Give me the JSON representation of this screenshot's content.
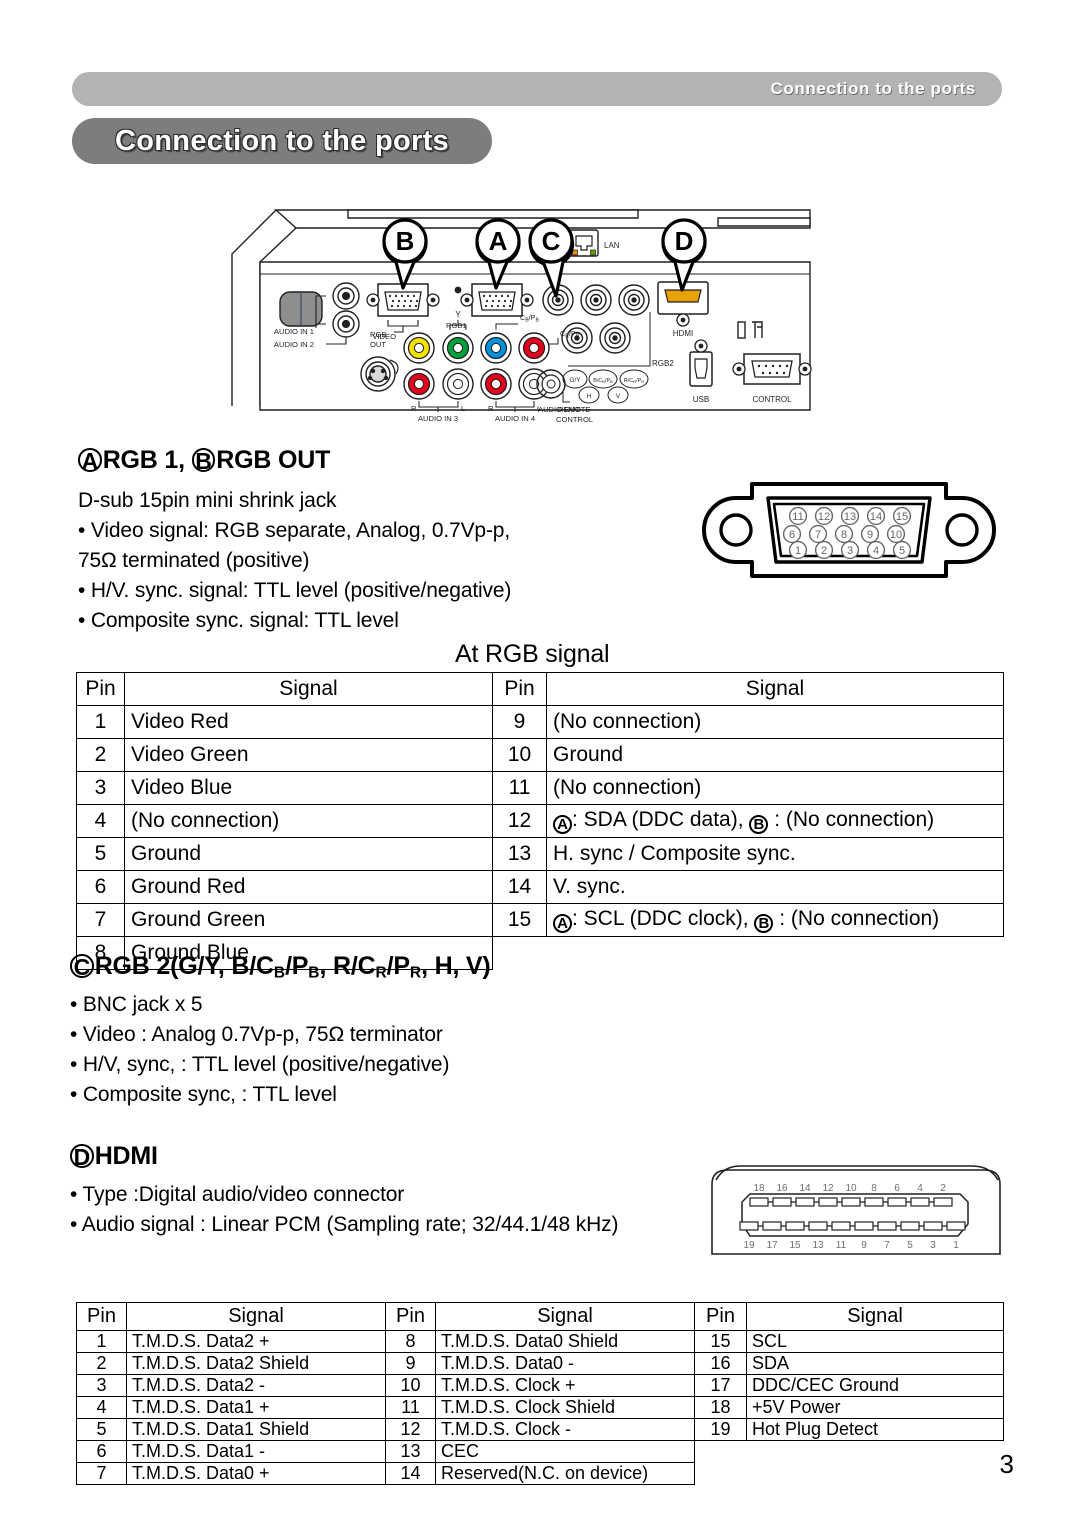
{
  "header": {
    "running_title": "Connection to the ports",
    "chapter_title": "Connection to the ports"
  },
  "diagram": {
    "callouts": [
      "B",
      "A",
      "C",
      "D"
    ],
    "labels": {
      "audio_in_1": "AUDIO IN 1",
      "audio_in_2": "AUDIO IN 2",
      "rgb_out": "RGB\nOUT",
      "rgb_out_l1": "RGB",
      "rgb_out_l2": "OUT",
      "rgb1": "RGB1",
      "video": "VIDEO",
      "y": "Y",
      "cb_pb": "CB/PB",
      "cr_pr": "CR/PR",
      "r1": "R",
      "l1": "L",
      "audio_in_3": "AUDIO IN 3",
      "r2": "R",
      "l2": "L",
      "audio_in_4": "AUDIO IN 4",
      "audio_out": "AUDIO OUT",
      "remote_control_l1": "REMOTE",
      "remote_control_l2": "CONTROL",
      "lan": "LAN",
      "hdmi": "HDMI",
      "rgb2": "RGB2",
      "rgb2_gy": "G/Y",
      "rgb2_b": "B/CB/PB",
      "rgb2_r": "R/CR/PR",
      "rgb2_h": "H",
      "rgb2_v": "V",
      "usb": "USB",
      "control": "CONTROL"
    }
  },
  "rgb_section": {
    "heading_marker_a": "A",
    "heading_text_a": "RGB 1, ",
    "heading_marker_b": "B",
    "heading_text_b": "RGB OUT",
    "body": [
      "D-sub 15pin mini shrink jack",
      "• Video signal: RGB separate, Analog, 0.7Vp-p,",
      "75Ω terminated (positive)",
      "• H/V. sync. signal: TTL level (positive/negative)",
      "• Composite sync. signal: TTL level"
    ],
    "connector_pins_top": [
      "11",
      "12",
      "13",
      "14",
      "15"
    ],
    "connector_pins_mid": [
      "6",
      "7",
      "8",
      "9",
      "10"
    ],
    "connector_pins_bottom": [
      "1",
      "2",
      "3",
      "4",
      "5"
    ]
  },
  "rgb_table": {
    "caption": "At RGB signal",
    "headers": [
      "Pin",
      "Signal",
      "Pin",
      "Signal"
    ],
    "rows": [
      {
        "pin_l": "1",
        "sig_l": "Video Red",
        "pin_r": "9",
        "sig_r": "(No connection)"
      },
      {
        "pin_l": "2",
        "sig_l": "Video Green",
        "pin_r": "10",
        "sig_r": "Ground"
      },
      {
        "pin_l": "3",
        "sig_l": "Video Blue",
        "pin_r": "11",
        "sig_r": "(No connection)"
      },
      {
        "pin_l": "4",
        "sig_l": "(No connection)",
        "pin_r": "12",
        "sig_r": "",
        "sig_r_ab": {
          "a": "A",
          "a_text": ": SDA (DDC data), ",
          "b": "B",
          "b_text": " : (No connection)"
        }
      },
      {
        "pin_l": "5",
        "sig_l": "Ground",
        "pin_r": "13",
        "sig_r": "H. sync / Composite sync."
      },
      {
        "pin_l": "6",
        "sig_l": "Ground Red",
        "pin_r": "14",
        "sig_r": "V. sync."
      },
      {
        "pin_l": "7",
        "sig_l": "Ground Green",
        "pin_r": "15",
        "sig_r": "",
        "sig_r_ab": {
          "a": "A",
          "a_text": ": SCL (DDC clock), ",
          "b": "B",
          "b_text": " : (No connection)"
        }
      },
      {
        "pin_l": "8",
        "sig_l": "Ground Blue",
        "pin_r": "",
        "sig_r": ""
      }
    ]
  },
  "rgb2_section": {
    "heading_marker": "C",
    "heading_text": "RGB 2(G/Y, B/CB/PB, R/CR/PR, H, V)",
    "body": [
      "• BNC jack x 5",
      "• Video : Analog 0.7Vp-p, 75Ω terminator",
      "• H/V, sync, : TTL level (positive/negative)",
      "• Composite sync, : TTL level"
    ]
  },
  "hdmi_section": {
    "heading_marker": "D",
    "heading_text": "HDMI",
    "body": [
      "• Type :Digital audio/video connector",
      "• Audio signal : Linear PCM (Sampling rate; 32/44.1/48 kHz)"
    ],
    "connector_pins_top": [
      "18",
      "16",
      "14",
      "12",
      "10",
      "8",
      "6",
      "4",
      "2"
    ],
    "connector_pins_bottom": [
      "19",
      "17",
      "15",
      "13",
      "11",
      "9",
      "7",
      "5",
      "3",
      "1"
    ]
  },
  "hdmi_table": {
    "headers": [
      "Pin",
      "Signal",
      "Pin",
      "Signal",
      "Pin",
      "Signal"
    ],
    "rows": [
      {
        "p1": "1",
        "s1": "T.M.D.S. Data2 +",
        "p2": "8",
        "s2": "T.M.D.S. Data0 Shield",
        "p3": "15",
        "s3": "SCL"
      },
      {
        "p1": "2",
        "s1": "T.M.D.S. Data2 Shield",
        "p2": "9",
        "s2": "T.M.D.S. Data0 -",
        "p3": "16",
        "s3": "SDA"
      },
      {
        "p1": "3",
        "s1": "T.M.D.S. Data2 -",
        "p2": "10",
        "s2": "T.M.D.S. Clock +",
        "p3": "17",
        "s3": "DDC/CEC Ground"
      },
      {
        "p1": "4",
        "s1": "T.M.D.S. Data1 +",
        "p2": "11",
        "s2": "T.M.D.S. Clock Shield",
        "p3": "18",
        "s3": "+5V Power"
      },
      {
        "p1": "5",
        "s1": "T.M.D.S. Data1 Shield",
        "p2": "12",
        "s2": "T.M.D.S. Clock -",
        "p3": "19",
        "s3": "Hot Plug Detect"
      },
      {
        "p1": "6",
        "s1": "T.M.D.S. Data1 -",
        "p2": "13",
        "s2": "CEC",
        "p3": "",
        "s3": ""
      },
      {
        "p1": "7",
        "s1": "T.M.D.S. Data0 +",
        "p2": "14",
        "s2": "Reserved(N.C. on device)",
        "p3": "",
        "s3": ""
      }
    ]
  },
  "page_number": "3",
  "colors": {
    "running_band": "#b3b3b3",
    "chapter_pill": "#7d7d7d",
    "jack_yellow": "#f5e200",
    "jack_green": "#00a13b",
    "jack_blue": "#0090d8",
    "jack_red": "#e2001a"
  }
}
